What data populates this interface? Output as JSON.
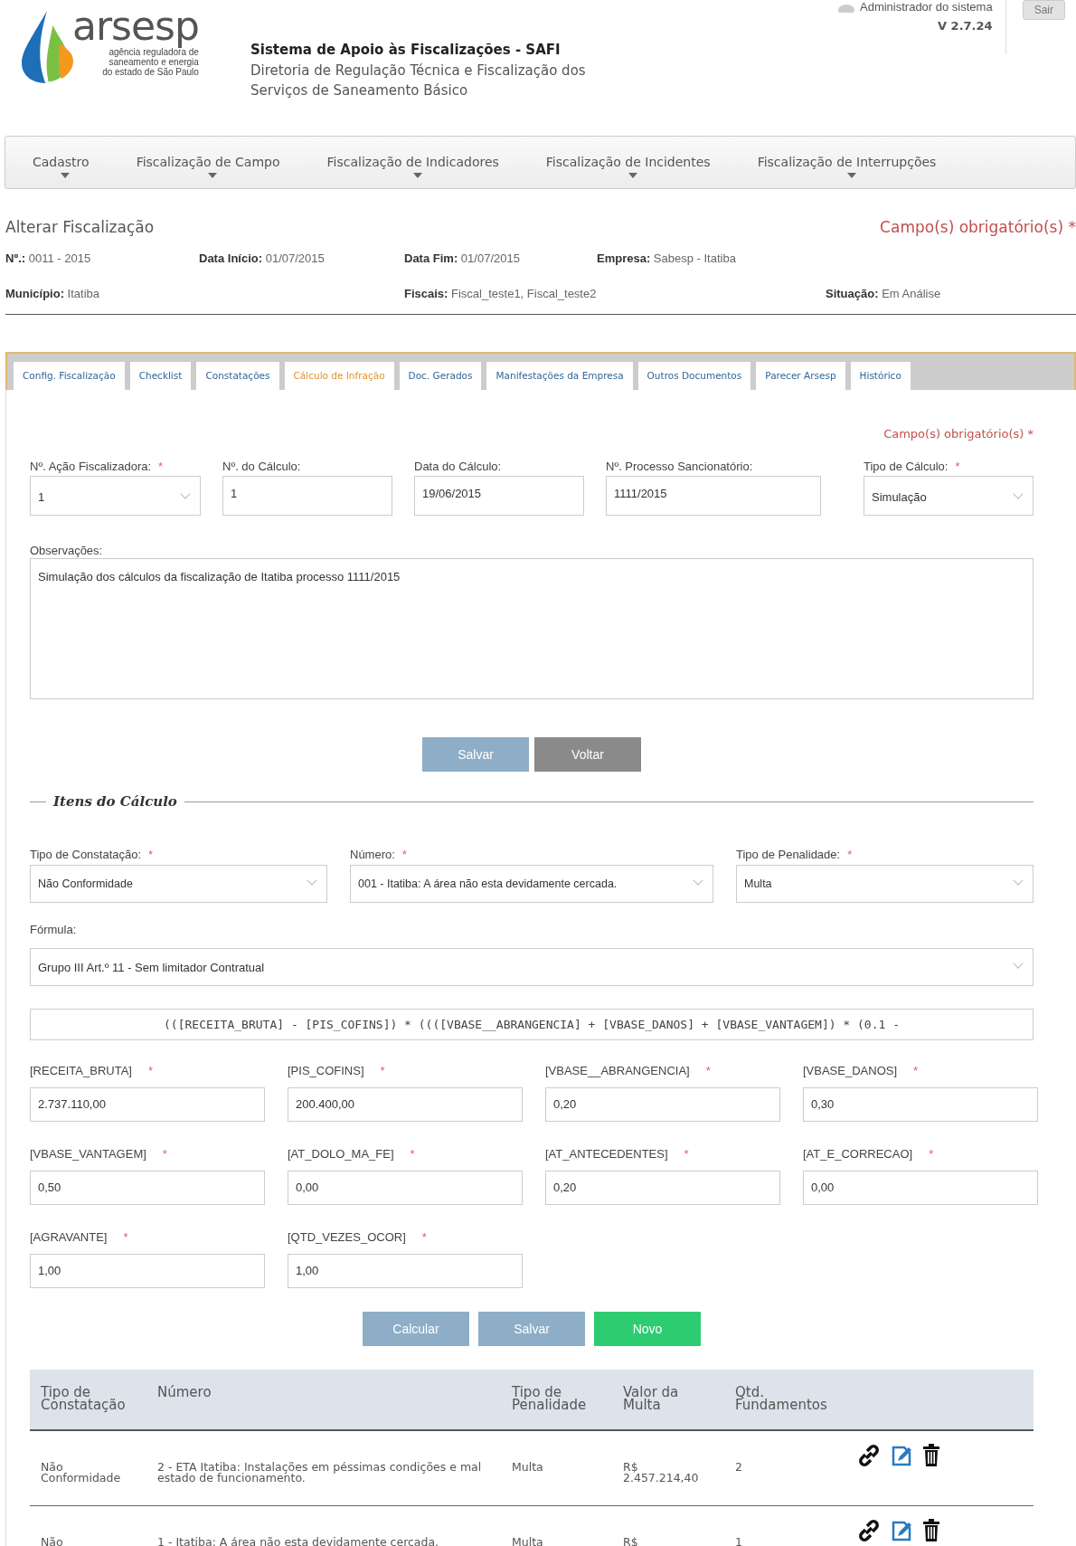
{
  "header": {
    "logo": {
      "name": "arsesp",
      "tagline": [
        "agência reguladora de",
        "saneamento e energia",
        "do estado de São Paulo"
      ]
    },
    "system_title": "Sistema de Apoio às Fiscalizações - SAFI",
    "subtitle": [
      "Diretoria de Regulação Técnica e Fiscalização dos",
      "Serviços de Saneamento Básico"
    ],
    "user": "Administrador do sistema",
    "version": "V 2.7.24",
    "logout": "Sair"
  },
  "nav": [
    {
      "label": "Cadastro"
    },
    {
      "label": "Fiscalização de Campo"
    },
    {
      "label": "Fiscalização de Indicadores"
    },
    {
      "label": "Fiscalização de Incidentes"
    },
    {
      "label": "Fiscalização de Interrupções"
    }
  ],
  "page_title": "Alterar Fiscalização",
  "required_note": "Campo(s) obrigatório(s) *",
  "info": [
    [
      {
        "label": "Nº.:",
        "value": "0011 - 2015"
      },
      {
        "label": "Data Início:",
        "value": "01/07/2015"
      },
      {
        "label": "Data Fim:",
        "value": "01/07/2015"
      },
      {
        "label": "Empresa:",
        "value": "Sabesp - Itatiba"
      }
    ],
    [
      {
        "label": "Município:",
        "value": "Itatiba"
      },
      {
        "label": "Fiscais:",
        "value": "Fiscal_teste1, Fiscal_teste2"
      },
      {
        "label": "Situação:",
        "value": "Em Análise"
      }
    ]
  ],
  "tabs": [
    {
      "label": "Config. Fiscalização",
      "selected": false
    },
    {
      "label": "Checklist",
      "selected": false
    },
    {
      "label": "Constatações",
      "selected": false
    },
    {
      "label": "Cálculo de Infração",
      "selected": true
    },
    {
      "label": "Doc. Gerados",
      "selected": false
    },
    {
      "label": "Manifestações da Empresa",
      "selected": false
    },
    {
      "label": "Outros Documentos",
      "selected": false
    },
    {
      "label": "Parecer Arsesp",
      "selected": false
    },
    {
      "label": "Histórico",
      "selected": false
    }
  ],
  "form": {
    "required_note": "Campo(s) obrigatório(s) *",
    "fields": [
      {
        "label": "Nº. Ação Fiscalizadora:",
        "required_mark": "*",
        "kind": "select",
        "value": "1"
      },
      {
        "label": "Nº. do Cálculo:",
        "kind": "text",
        "value": "1"
      },
      {
        "label": "Data do Cálculo:",
        "kind": "text",
        "value": "19/06/2015"
      },
      {
        "label": "Nº. Processo Sancionatório:",
        "kind": "text",
        "value": "1111/2015"
      },
      {
        "label": "Tipo de Cálculo:",
        "required_mark": "*",
        "kind": "select",
        "value": "Simulação"
      }
    ],
    "observations": {
      "label": "Observações:",
      "value": "Simulação dos cálculos da fiscalização de Itatiba processo 1111/2015"
    },
    "buttons": [
      {
        "label": "Salvar",
        "kind": "primary"
      },
      {
        "label": "Voltar",
        "kind": "secondary"
      }
    ]
  },
  "items": {
    "legend": "Itens do Cálculo",
    "selects": [
      {
        "label": "Tipo de Constatação:",
        "required_mark": "*",
        "value": "Não Conformidade"
      },
      {
        "label": "Número:",
        "required_mark": "*",
        "value": "001 - Itatiba: A área não esta devidamente cercada."
      },
      {
        "label": "Tipo de Penalidade:",
        "required_mark": "*",
        "value": "Multa"
      }
    ],
    "formula": {
      "label": "Fórmula:",
      "value": "Grupo III Art.º 11 - Sem limitador Contratual"
    },
    "expression": "(([RECEITA_BRUTA] - [PIS_COFINS]) * ((([VBASE__ABRANGENCIA] + [VBASE_DANOS] + [VBASE_VANTAGEM]) * (0.1 -",
    "params": [
      {
        "label": "[RECEITA_BRUTA]",
        "required_mark": "*",
        "value": "2.737.110,00"
      },
      {
        "label": "[PIS_COFINS]",
        "required_mark": "*",
        "value": "200.400,00"
      },
      {
        "label": "[VBASE__ABRANGENCIA]",
        "required_mark": "*",
        "value": "0,20"
      },
      {
        "label": "[VBASE_DANOS]",
        "required_mark": "*",
        "value": "0,30"
      },
      {
        "label": "[VBASE_VANTAGEM]",
        "required_mark": "*",
        "value": "0,50"
      },
      {
        "label": "[AT_DOLO_MA_FE]",
        "required_mark": "*",
        "value": "0,00"
      },
      {
        "label": "[AT_ANTECEDENTES]",
        "required_mark": "*",
        "value": "0,20"
      },
      {
        "label": "[AT_E_CORRECAO]",
        "required_mark": "*",
        "value": "0,00"
      },
      {
        "label": "[AGRAVANTE]",
        "required_mark": "*",
        "value": "1,00"
      },
      {
        "label": "[QTD_VEZES_OCOR]",
        "required_mark": "*",
        "value": "1,00"
      }
    ],
    "buttons": [
      {
        "label": "Calcular",
        "kind": "primary"
      },
      {
        "label": "Salvar",
        "kind": "primary"
      },
      {
        "label": "Novo",
        "kind": "success"
      }
    ]
  },
  "table": {
    "columns": [
      "Tipo de Constatação",
      "Número",
      "Tipo de Penalidade",
      "Valor da Multa",
      "Qtd. Fundamentos"
    ],
    "rows": [
      [
        "Não Conformidade",
        "2 - ETA Itatiba: Instalações em péssimas condições e mal estado de funcionamento.",
        "Multa",
        "R$ 2.457.214,40",
        "2"
      ],
      [
        "Não",
        "1 - Itatiba: A área não esta devidamente cercada.",
        "Multa",
        "R$",
        "1"
      ]
    ]
  }
}
